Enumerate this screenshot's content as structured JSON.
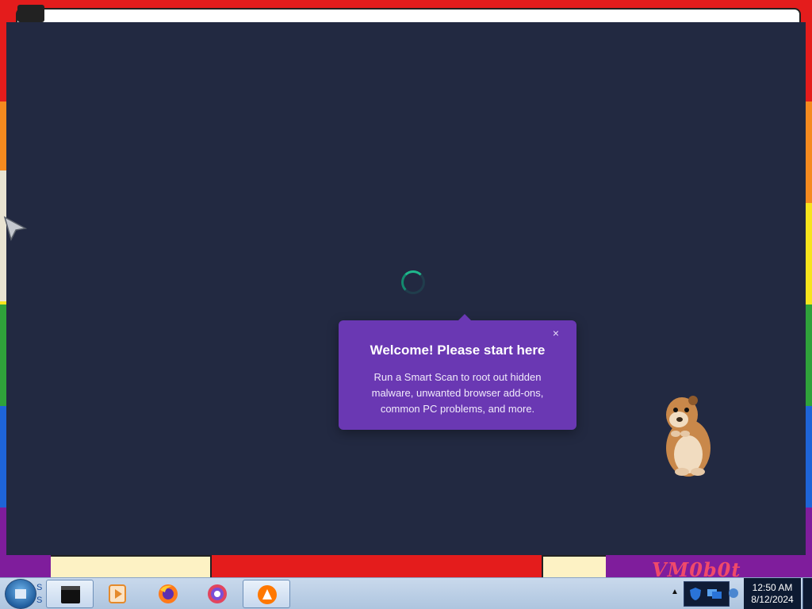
{
  "desktop": {
    "watermark_text": "VM0b0t",
    "start_text": "S S"
  },
  "popup": {
    "title": "Welcome! Please start here",
    "body": "Run a Smart Scan to root out hidden malware, unwanted browser add-ons, common PC problems, and more.",
    "close_label": "×"
  },
  "taskbar": {
    "apps": [
      {
        "name": "terminal-app-icon"
      },
      {
        "name": "media-player-icon"
      },
      {
        "name": "firefox-icon"
      },
      {
        "name": "browser-icon"
      },
      {
        "name": "avast-app-icon"
      }
    ],
    "clock": {
      "time": "12:50 AM",
      "date": "8/12/2024"
    }
  },
  "colors": {
    "app_background": "#222941",
    "popup_background": "#6a38b3",
    "spinner_accent": "#1fb88c"
  }
}
